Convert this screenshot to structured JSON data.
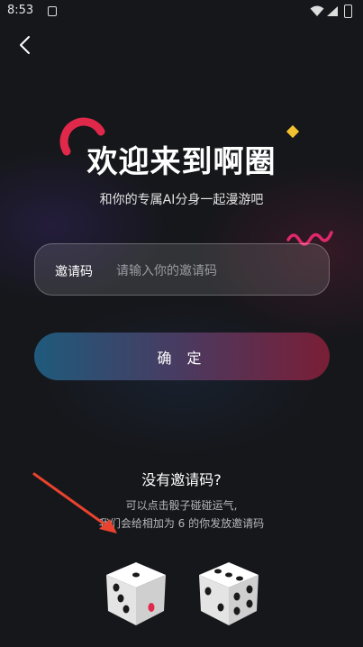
{
  "status_bar": {
    "time": "8:53"
  },
  "header": {
    "back_icon": "chevron-left-icon"
  },
  "hero": {
    "title": "欢迎来到啊圈",
    "subtitle": "和你的专属AI分身一起漫游吧"
  },
  "invite": {
    "label": "邀请码",
    "placeholder": "请输入你的邀请码",
    "value": ""
  },
  "confirm": {
    "label": "确 定"
  },
  "no_code": {
    "heading": "没有邀请码?",
    "hint_line1": "可以点击骰子碰碰运气,",
    "hint_line2": "我们会给相加为 6 的你发放邀请码"
  },
  "dice": {
    "left_face": 5,
    "right_face": 6
  },
  "colors": {
    "background": "#16171b",
    "accent_red": "#e0284a",
    "accent_yellow": "#f2c230",
    "button_gradient_start": "#1f5a7c",
    "button_gradient_end": "#7a1e36",
    "annotation_arrow": "#e8432e"
  }
}
